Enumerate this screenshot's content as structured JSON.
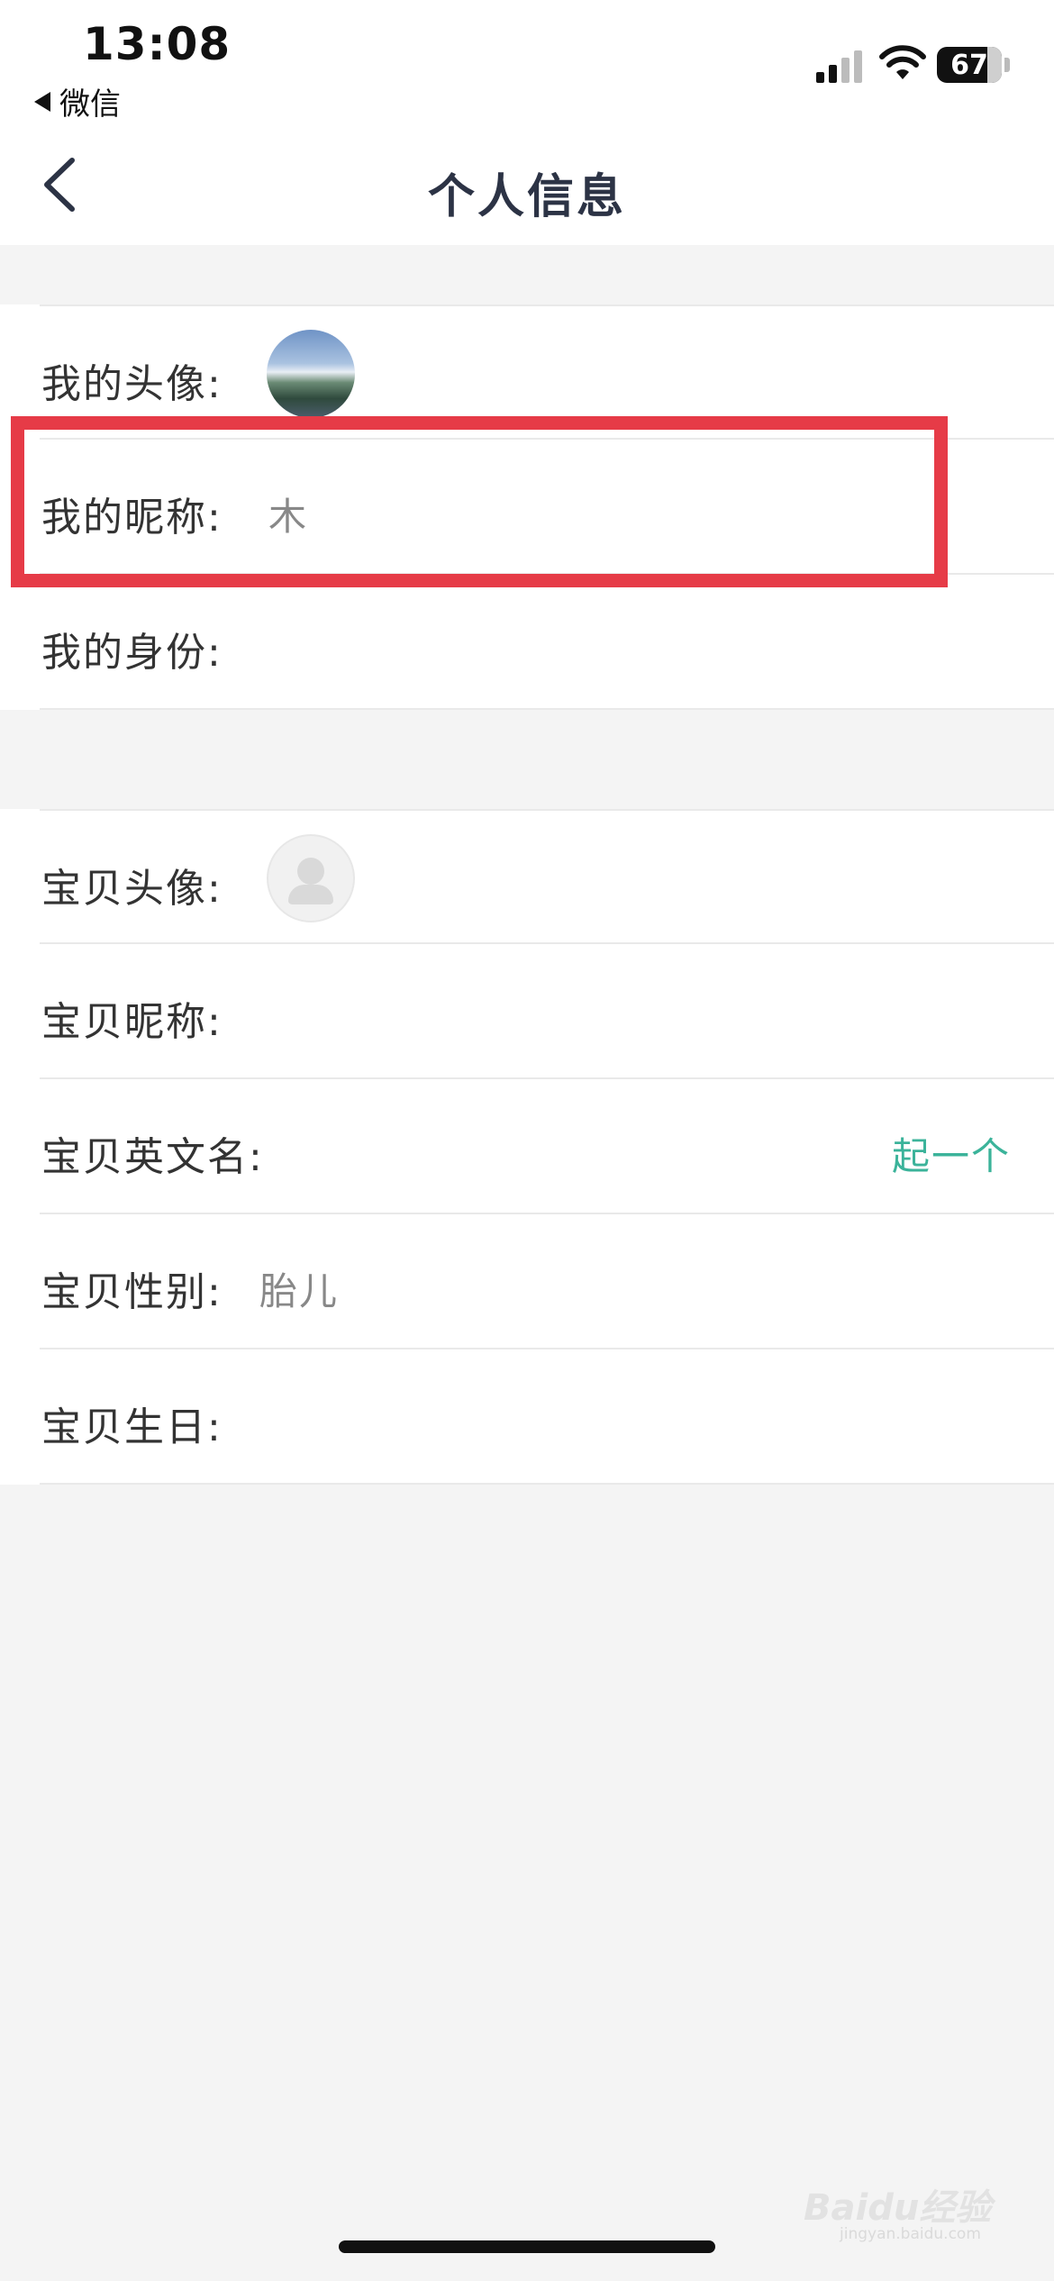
{
  "status_bar": {
    "time": "13:08",
    "back_app_label": "微信",
    "battery_level": "67",
    "signal_bars_filled": 2,
    "signal_bars_total": 4
  },
  "nav": {
    "title": "个人信息",
    "back_icon": "chevron-left-icon"
  },
  "profile_section": {
    "rows": [
      {
        "label": "我的头像:"
      },
      {
        "label": "我的昵称:",
        "value": "木"
      },
      {
        "label": "我的身份:",
        "value": ""
      }
    ]
  },
  "baby_section": {
    "rows": [
      {
        "label": "宝贝头像:"
      },
      {
        "label": "宝贝昵称:",
        "value": ""
      },
      {
        "label": "宝贝英文名:",
        "action": "起一个"
      },
      {
        "label": "宝贝性别:",
        "value": "胎儿"
      },
      {
        "label": "宝贝生日:",
        "value": ""
      }
    ]
  },
  "watermark": {
    "brand": "Baidu经验",
    "url": "jingyan.baidu.com"
  },
  "colors": {
    "highlight": "#e63b47",
    "action": "#3bb39a",
    "background": "#f4f4f4"
  }
}
